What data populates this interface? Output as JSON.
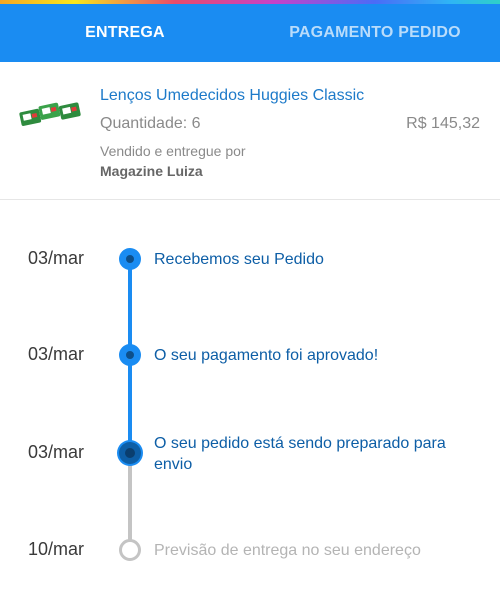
{
  "tabs": [
    {
      "label": "ENTREGA",
      "active": true
    },
    {
      "label": "PAGAMENTO PEDIDO",
      "active": false
    }
  ],
  "product": {
    "title": "Lenços Umedecidos Huggies Classic",
    "quantity": "Quantidade: 6",
    "price": "R$ 145,32",
    "sold_by_label": "Vendido e entregue por",
    "seller": "Magazine Luiza",
    "thumbnail_icon": "product-thumbnail"
  },
  "timeline": [
    {
      "date": "03/mar",
      "text": "Recebemos seu Pedido",
      "status": "done"
    },
    {
      "date": "03/mar",
      "text": "O seu pagamento foi aprovado!",
      "status": "done"
    },
    {
      "date": "03/mar",
      "text": "O seu pedido está sendo preparado para envio",
      "status": "current"
    },
    {
      "date": "10/mar",
      "text": "Previsão de entrega no seu endereço",
      "status": "pending"
    }
  ],
  "colors": {
    "primary": "#1a8cf2",
    "text_blue": "#0d5ea6",
    "pending": "#c4c4c4"
  }
}
